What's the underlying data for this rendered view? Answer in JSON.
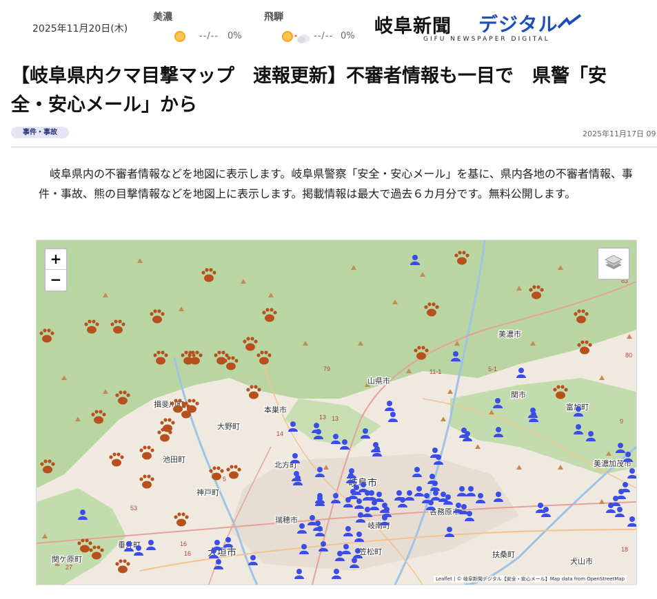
{
  "header": {
    "date": "2025年11月20日(木)",
    "weather": [
      {
        "region": "美濃",
        "temp": "--/--",
        "precip": "0%",
        "icon": "sunny-icon"
      },
      {
        "region": "飛騨",
        "temp": "--/--",
        "precip": "0%",
        "icon": "sunny-then-cloudy-icon"
      }
    ],
    "logo": {
      "main": "岐阜新聞",
      "digital": "デジタル",
      "sub": "GIFU NEWSPAPER DIGITAL"
    }
  },
  "article": {
    "title": "【岐阜県内クマ目撃マップ　速報更新】不審者情報も一目で　県警「安全・安心メール」から",
    "category": "事件・事故",
    "published": "2025年11月17日 09:",
    "lead": "岐阜県内の不審者情報などを地図に表示します。岐阜県警察「安全・安心メール」を基に、県内各地の不審者情報、事件・事故、熊の目撃情報などを地図上に表示します。掲載情報は最大で過去６カ月分です。無料公開します。"
  },
  "map": {
    "zoom_in": "+",
    "zoom_out": "−",
    "layers_icon": "layers-icon",
    "attribution": "Leaflet | © 岐阜新聞デジタル【安全・安心メール】Map data from OpenStreetMap",
    "labels": [
      "美濃市",
      "山県市",
      "関市",
      "本巣市",
      "揖斐川町",
      "池田町",
      "北方町",
      "岐阜市",
      "各務原市",
      "神戸町",
      "瑞穂市",
      "岐南町",
      "笠松町",
      "大垣市",
      "垂井町",
      "関ケ原町",
      "扶桑町",
      "犬山市",
      "美濃加茂市",
      "富加町",
      "大野町"
    ],
    "road_numbers": [
      "79",
      "63",
      "80",
      "53",
      "16",
      "16",
      "14",
      "13",
      "13",
      "5",
      "27",
      "11-1",
      "5-1",
      "9",
      "18"
    ],
    "marker_legend": {
      "bear": "bear-paw-icon",
      "suspicious": "person-icon"
    }
  },
  "colors": {
    "bear": "#b8501d",
    "person": "#3a4ee6",
    "forest": "#b9d6a2",
    "urban": "#efe9df",
    "tag_bg": "#e4e6f6",
    "logo_blue": "#1e4fb8"
  }
}
